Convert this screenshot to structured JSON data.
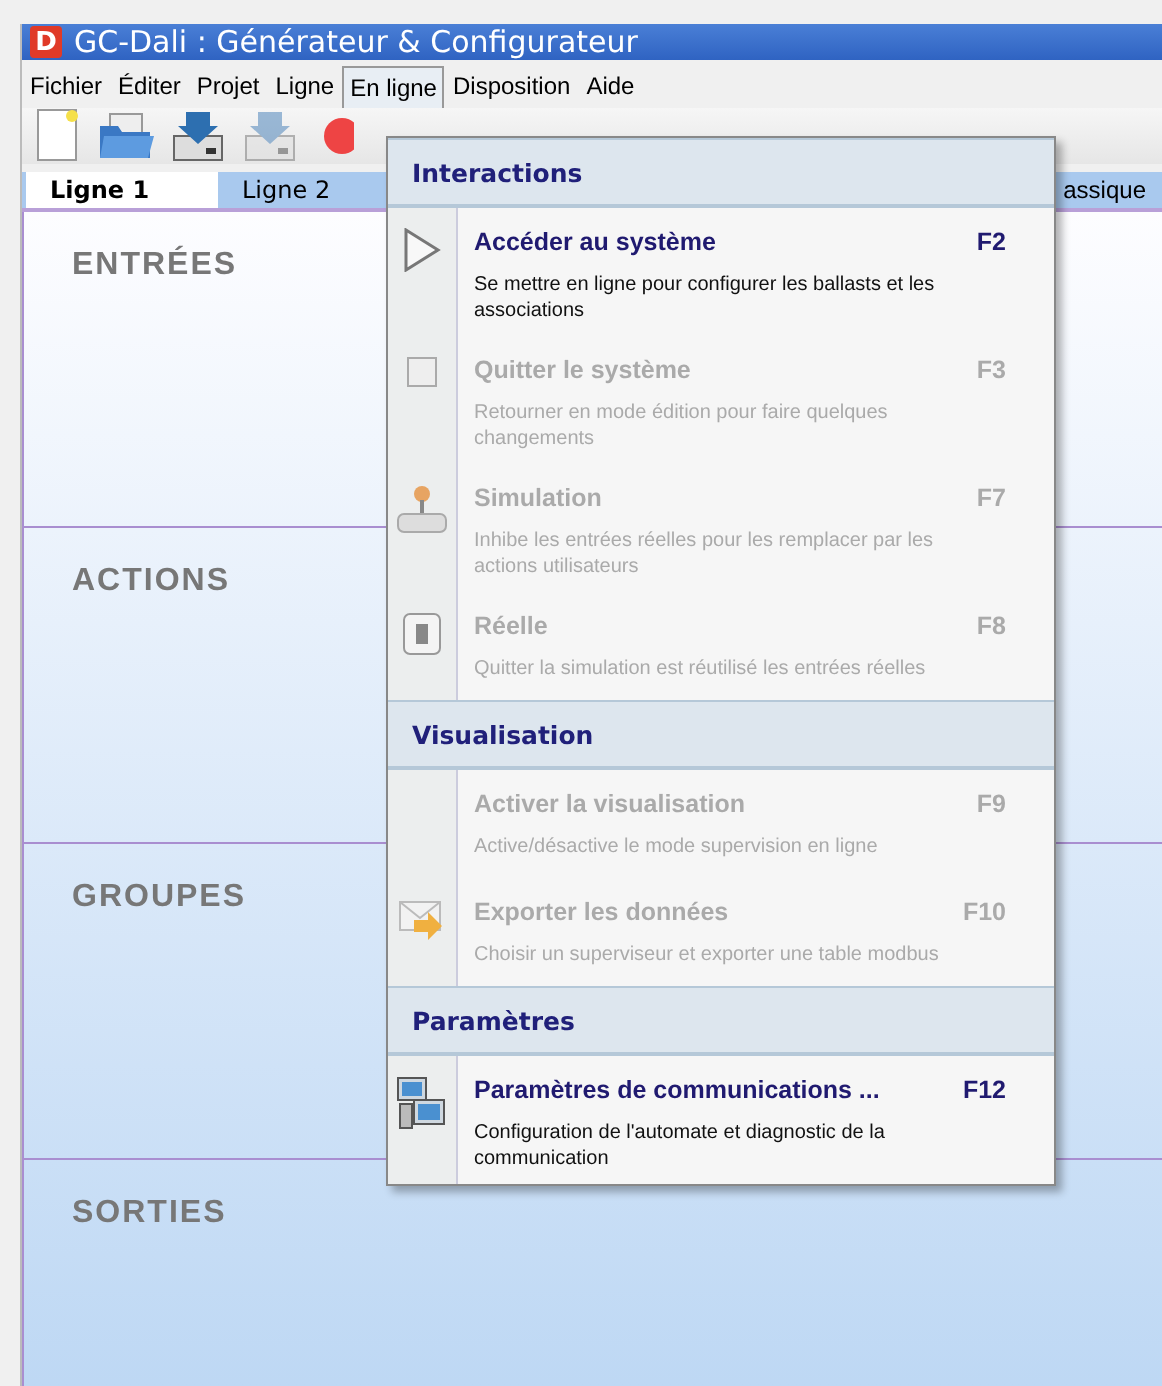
{
  "window": {
    "title": "GC-Dali : Générateur & Configurateur",
    "logo": "D"
  },
  "menu_bar": [
    {
      "label": "Fichier",
      "selected": false
    },
    {
      "label": "Éditer",
      "selected": false
    },
    {
      "label": "Projet",
      "selected": false
    },
    {
      "label": "Ligne",
      "selected": false
    },
    {
      "label": "En ligne",
      "selected": true
    },
    {
      "label": "Disposition",
      "selected": false
    },
    {
      "label": "Aide",
      "selected": false
    }
  ],
  "toolbar": [
    {
      "kind": "new",
      "disabled": false
    },
    {
      "kind": "open",
      "disabled": false
    },
    {
      "kind": "save",
      "disabled": false
    },
    {
      "kind": "save",
      "disabled": true
    },
    {
      "kind": "record",
      "disabled": false
    }
  ],
  "tabs": [
    {
      "label": "Ligne 1",
      "selected": true
    },
    {
      "label": "Ligne 2",
      "selected": false
    },
    {
      "label": "assique",
      "selected": false
    }
  ],
  "sections": [
    "ENTRÉES",
    "ACTIONS",
    "GROUPES",
    "SORTIES"
  ],
  "dropdown": {
    "groups": [
      {
        "title": "Interactions",
        "items": [
          {
            "kind": "play",
            "label": "Accéder au système",
            "shortcut": "F2",
            "description": "Se mettre en ligne pour configurer les ballasts et les associations",
            "disabled": false
          },
          {
            "kind": "stop",
            "label": "Quitter le système",
            "shortcut": "F3",
            "description": "Retourner en mode édition pour faire quelques changements",
            "disabled": true
          },
          {
            "kind": "joystick",
            "label": "Simulation",
            "shortcut": "F7",
            "description": "Inhibe les entrées réelles pour les remplacer par les actions utilisateurs",
            "disabled": true
          },
          {
            "kind": "switch",
            "label": "Réelle",
            "shortcut": "F8",
            "description": "Quitter la simulation est réutilisé les entrées réelles",
            "disabled": true
          }
        ]
      },
      {
        "title": "Visualisation",
        "items": [
          {
            "kind": "none",
            "label": "Activer la visualisation",
            "shortcut": "F9",
            "description": "Active/désactive le mode supervision en ligne",
            "disabled": true
          },
          {
            "kind": "export",
            "label": "Exporter les données",
            "shortcut": "F10",
            "description": "Choisir un superviseur et exporter une table modbus",
            "disabled": true
          }
        ]
      },
      {
        "title": "Paramètres",
        "items": [
          {
            "kind": "network",
            "label": "Paramètres de communications ...",
            "shortcut": "F12",
            "description": "Configuration de l'automate et diagnostic de la communication",
            "disabled": false
          }
        ]
      }
    ]
  }
}
